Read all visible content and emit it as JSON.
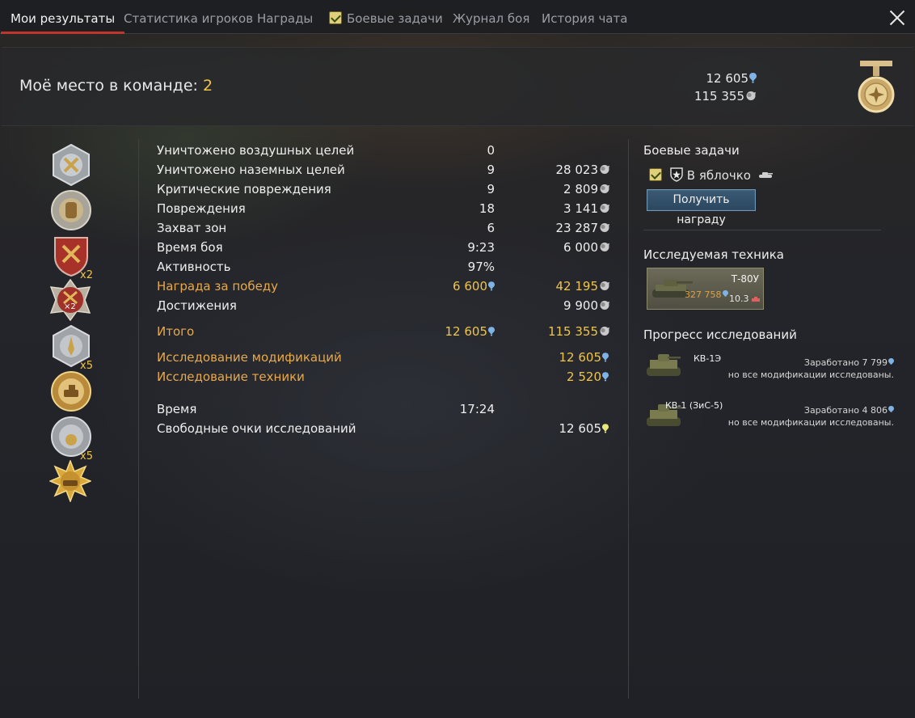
{
  "tabs": [
    {
      "label": "Мои результаты",
      "active": true
    },
    {
      "label": "Статистика игроков",
      "active": false
    },
    {
      "label": "Награды",
      "active": false
    },
    {
      "label": "Боевые задачи",
      "active": false,
      "checkbox": true
    },
    {
      "label": "Журнал боя",
      "active": false
    },
    {
      "label": "История чата",
      "active": false
    }
  ],
  "header": {
    "place_label": "Моё место в команде:",
    "place_value": "2",
    "rp_total": "12 605",
    "sl_total": "115 355"
  },
  "medals": [
    {
      "name": "medal-crossed-swords",
      "multiplier": ""
    },
    {
      "name": "medal-fist",
      "multiplier": ""
    },
    {
      "name": "medal-red-shield",
      "multiplier": "x2"
    },
    {
      "name": "medal-red-badge",
      "multiplier": ""
    },
    {
      "name": "medal-wings",
      "multiplier": "x5"
    },
    {
      "name": "medal-gold-tank",
      "multiplier": ""
    },
    {
      "name": "medal-laurel",
      "multiplier": "x5"
    },
    {
      "name": "medal-gold-star",
      "multiplier": ""
    }
  ],
  "medal_inner_badge": "×2",
  "stats": [
    {
      "label": "Уничтожено воздушных целей",
      "value": "0",
      "rp": "",
      "sl": ""
    },
    {
      "label": "Уничтожено наземных целей",
      "value": "9",
      "rp": "",
      "sl": "28 023"
    },
    {
      "label": "Критические повреждения",
      "value": "9",
      "rp": "",
      "sl": "2 809"
    },
    {
      "label": "Повреждения",
      "value": "18",
      "rp": "",
      "sl": "3 141"
    },
    {
      "label": "Захват зон",
      "value": "6",
      "rp": "",
      "sl": "23 287"
    },
    {
      "label": "Время боя",
      "value": "9:23",
      "rp": "",
      "sl": "6 000"
    },
    {
      "label": "Активность",
      "value": "97%",
      "rp": "",
      "sl": ""
    },
    {
      "label": "Награда за победу",
      "value": "",
      "rp": "6 600",
      "sl": "42 195"
    },
    {
      "label": "Достижения",
      "value": "",
      "rp": "",
      "sl": "9 900"
    }
  ],
  "total": {
    "label": "Итого",
    "rp": "12 605",
    "sl": "115 355"
  },
  "research": [
    {
      "label": "Исследование модификаций",
      "value": "12 605"
    },
    {
      "label": "Исследование техники",
      "value": "2 520"
    }
  ],
  "time": {
    "label": "Время",
    "value": "17:24"
  },
  "free_rp": {
    "label": "Свободные очки исследований",
    "value": "12 605"
  },
  "right_panel": {
    "tasks_title": "Боевые задачи",
    "task_name": "В яблочко",
    "reward_button": "Получить награду",
    "research_vehicle_title": "Исследуемая техника",
    "vehicle": {
      "name": "Т-80У",
      "rp": "327 758",
      "br": "10.3"
    },
    "progress_title": "Прогресс исследований",
    "progress": [
      {
        "name": "КВ-1Э",
        "earned_label": "Заработано",
        "earned": "7 799",
        "note": "но все модификации исследованы."
      },
      {
        "name": "КВ-1 (ЗиС-5)",
        "earned_label": "Заработано",
        "earned": "4 806",
        "note": "но все модификации исследованы."
      }
    ]
  },
  "colors": {
    "accent_red": "#c1352a",
    "gold_text": "#f0c44a",
    "orange_label": "#e8a94a",
    "rp_blue": "#7fb3e6",
    "free_rp_green": "#e8e87a",
    "button_blue": "#2b4760"
  }
}
